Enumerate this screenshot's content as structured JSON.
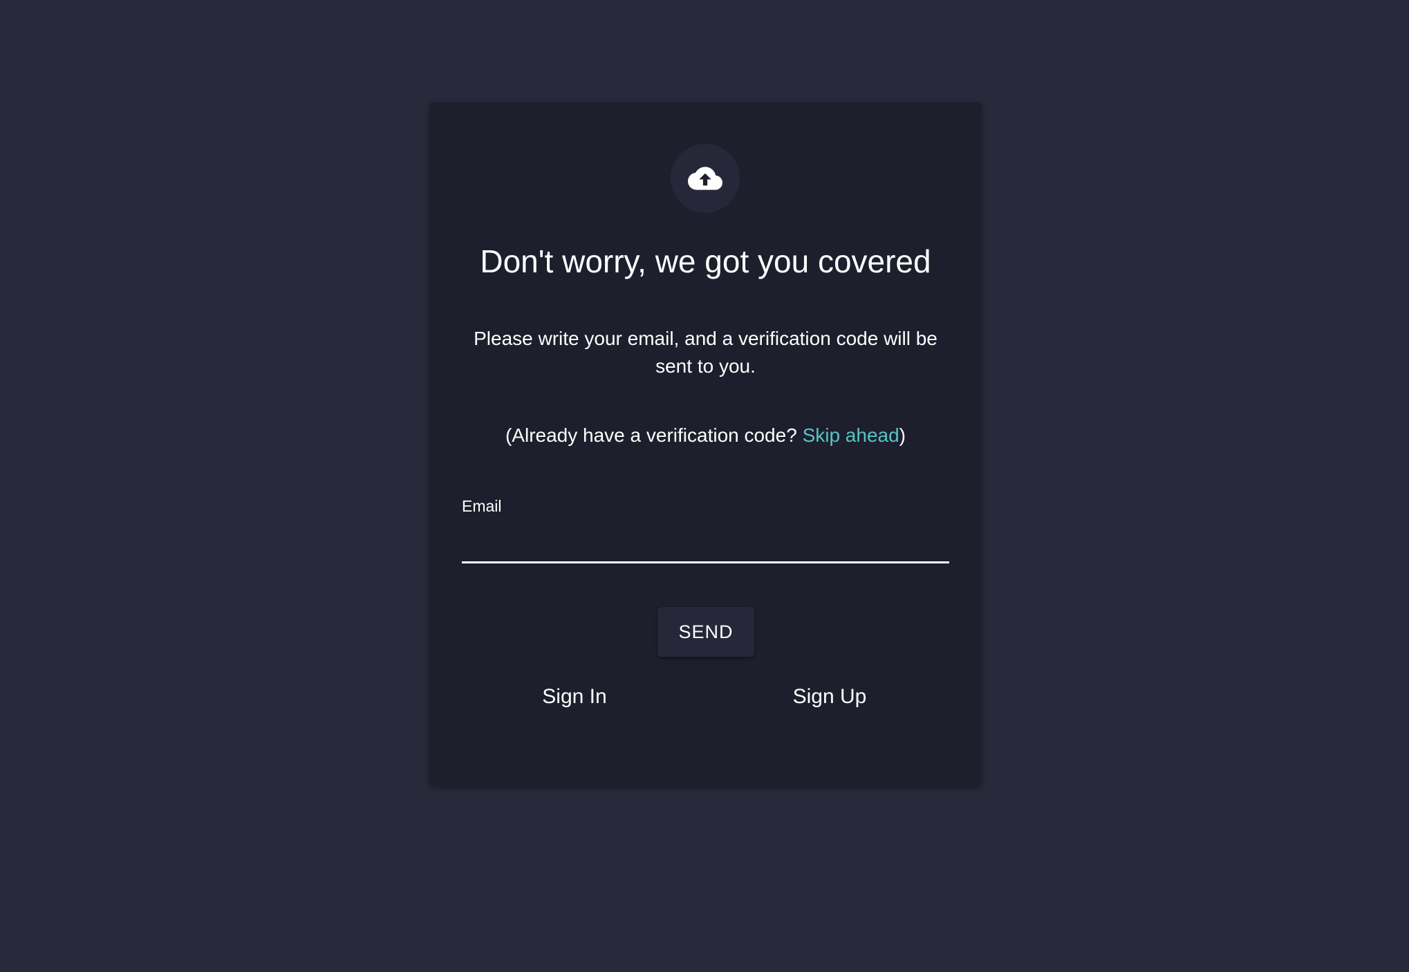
{
  "card": {
    "logo_icon": "cloud-upload-icon",
    "title": "Don't worry, we got you covered",
    "description": "Please write your email, and a verification code will be sent to you.",
    "already_prefix": "(Already have a verification code? ",
    "skip_link": "Skip ahead",
    "already_suffix": ")",
    "email_label": "Email",
    "email_value": "",
    "send_label": "SEND",
    "sign_in_label": "Sign In",
    "sign_up_label": "Sign Up"
  },
  "colors": {
    "page_background": "#28293b",
    "card_background": "#1e1f2d",
    "link_accent": "#57c4c7",
    "text": "#ffffff"
  }
}
